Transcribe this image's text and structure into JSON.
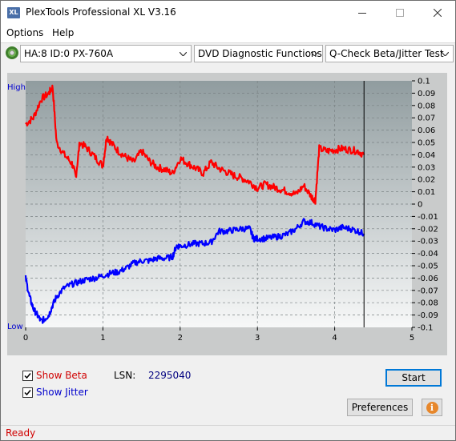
{
  "window": {
    "title": "PlexTools Professional XL V3.16",
    "app_icon_text": "XL"
  },
  "menu": {
    "options": "Options",
    "help": "Help"
  },
  "toolbar": {
    "drive": "HA:8 ID:0  PX-760A",
    "function": "DVD Diagnostic Functions",
    "test": "Q-Check Beta/Jitter Test"
  },
  "chart_data": {
    "type": "line",
    "title": "",
    "x_ticks": [
      "0",
      "1",
      "2",
      "3",
      "4",
      "5"
    ],
    "xlim": [
      0,
      5
    ],
    "left_axis": {
      "high_label": "High",
      "low_label": "Low"
    },
    "right_ticks": [
      "0.1",
      "0.09",
      "0.08",
      "0.07",
      "0.06",
      "0.05",
      "0.04",
      "0.03",
      "0.02",
      "0.01",
      "0",
      "-0.01",
      "-0.02",
      "-0.03",
      "-0.04",
      "-0.05",
      "-0.06",
      "-0.07",
      "-0.08",
      "-0.09",
      "-0.1"
    ],
    "ylim": [
      -0.1,
      0.1
    ],
    "grid": true,
    "end_marker_x": 4.38,
    "series": [
      {
        "color": "#ff0000",
        "x": [
          0.0,
          0.1,
          0.2,
          0.3,
          0.35,
          0.4,
          0.5,
          0.6,
          0.65,
          0.7,
          0.8,
          0.9,
          1.0,
          1.05,
          1.1,
          1.2,
          1.3,
          1.4,
          1.5,
          1.6,
          1.7,
          1.8,
          1.9,
          2.0,
          2.1,
          2.2,
          2.3,
          2.4,
          2.5,
          2.6,
          2.7,
          2.8,
          2.9,
          3.0,
          3.1,
          3.2,
          3.3,
          3.4,
          3.5,
          3.6,
          3.7,
          3.75,
          3.8,
          3.9,
          4.0,
          4.1,
          4.2,
          4.3,
          4.38
        ],
        "y": [
          0.065,
          0.07,
          0.085,
          0.09,
          0.095,
          0.05,
          0.04,
          0.033,
          0.022,
          0.05,
          0.045,
          0.038,
          0.031,
          0.055,
          0.05,
          0.043,
          0.038,
          0.034,
          0.043,
          0.035,
          0.03,
          0.028,
          0.025,
          0.037,
          0.033,
          0.029,
          0.025,
          0.034,
          0.029,
          0.026,
          0.023,
          0.021,
          0.018,
          0.013,
          0.016,
          0.014,
          0.012,
          0.01,
          0.008,
          0.015,
          0.006,
          0.003,
          0.045,
          0.043,
          0.044,
          0.045,
          0.044,
          0.043,
          0.04
        ]
      },
      {
        "color": "#0000ff",
        "x": [
          0.0,
          0.05,
          0.1,
          0.15,
          0.2,
          0.25,
          0.3,
          0.35,
          0.4,
          0.5,
          0.6,
          0.7,
          0.8,
          0.9,
          1.0,
          1.1,
          1.2,
          1.3,
          1.4,
          1.5,
          1.6,
          1.7,
          1.8,
          1.9,
          1.95,
          2.0,
          2.1,
          2.2,
          2.3,
          2.4,
          2.5,
          2.6,
          2.7,
          2.8,
          2.9,
          2.95,
          3.0,
          3.1,
          3.2,
          3.3,
          3.4,
          3.5,
          3.6,
          3.7,
          3.8,
          3.9,
          4.0,
          4.1,
          4.2,
          4.3,
          4.38
        ],
        "y": [
          -0.06,
          -0.075,
          -0.085,
          -0.09,
          -0.095,
          -0.093,
          -0.09,
          -0.082,
          -0.075,
          -0.068,
          -0.065,
          -0.063,
          -0.061,
          -0.06,
          -0.058,
          -0.056,
          -0.055,
          -0.052,
          -0.048,
          -0.046,
          -0.046,
          -0.044,
          -0.044,
          -0.043,
          -0.034,
          -0.034,
          -0.033,
          -0.032,
          -0.032,
          -0.031,
          -0.022,
          -0.022,
          -0.021,
          -0.02,
          -0.02,
          -0.028,
          -0.028,
          -0.028,
          -0.027,
          -0.026,
          -0.024,
          -0.02,
          -0.014,
          -0.015,
          -0.018,
          -0.02,
          -0.021,
          -0.019,
          -0.02,
          -0.022,
          -0.024
        ]
      }
    ]
  },
  "controls": {
    "show_beta_label": "Show Beta",
    "show_beta_checked": true,
    "show_jitter_label": "Show Jitter",
    "show_jitter_checked": true,
    "lsn_label": "LSN:",
    "lsn_value": "2295040",
    "start_button": "Start",
    "preferences_button": "Preferences",
    "info_icon_glyph": "i"
  },
  "status": {
    "text": "Ready"
  }
}
